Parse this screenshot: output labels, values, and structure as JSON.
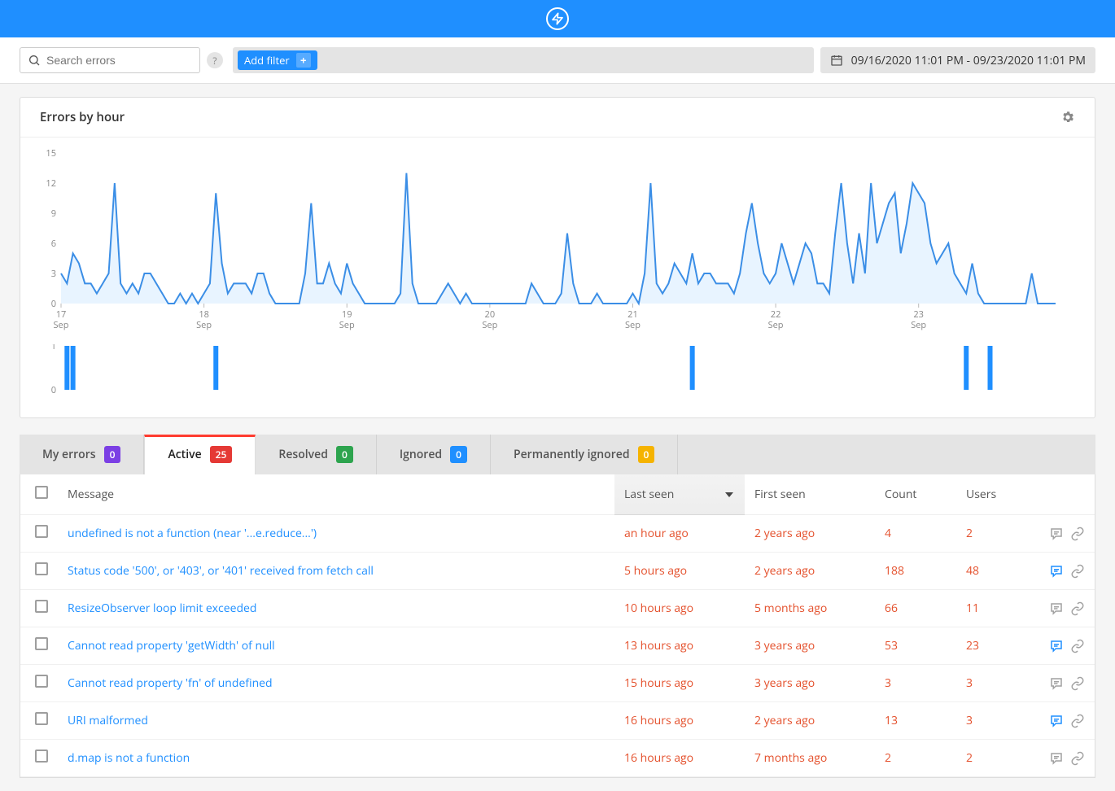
{
  "header": {
    "brand": "bolt"
  },
  "toolbar": {
    "search_placeholder": "Search errors",
    "help_label": "?",
    "add_filter_label": "Add filter",
    "date_range": "09/16/2020 11:01 PM - 09/23/2020 11:01 PM"
  },
  "chart": {
    "title": "Errors by hour",
    "y_ticks": [
      0,
      3,
      6,
      9,
      12,
      15
    ],
    "x_ticks": [
      {
        "day": "17",
        "month": "Sep"
      },
      {
        "day": "18",
        "month": "Sep"
      },
      {
        "day": "19",
        "month": "Sep"
      },
      {
        "day": "20",
        "month": "Sep"
      },
      {
        "day": "21",
        "month": "Sep"
      },
      {
        "day": "22",
        "month": "Sep"
      },
      {
        "day": "23",
        "month": "Sep"
      }
    ]
  },
  "mini_chart": {
    "y_ticks": [
      0,
      1
    ]
  },
  "tabs": [
    {
      "label": "My errors",
      "count": "0",
      "badge_class": "badge-purple"
    },
    {
      "label": "Active",
      "count": "25",
      "badge_class": "badge-red",
      "active": true
    },
    {
      "label": "Resolved",
      "count": "0",
      "badge_class": "badge-green"
    },
    {
      "label": "Ignored",
      "count": "0",
      "badge_class": "badge-blue"
    },
    {
      "label": "Permanently ignored",
      "count": "0",
      "badge_class": "badge-yellow"
    }
  ],
  "table": {
    "columns": {
      "message": "Message",
      "last_seen": "Last seen",
      "first_seen": "First seen",
      "count": "Count",
      "users": "Users"
    },
    "rows": [
      {
        "message": "undefined is not a function (near '...e.reduce...')",
        "last_seen": "an hour ago",
        "first_seen": "2 years ago",
        "count": "4",
        "users": "2",
        "has_comment": false
      },
      {
        "message": "Status code '500', or '403', or '401' received from fetch call",
        "last_seen": "5 hours ago",
        "first_seen": "2 years ago",
        "count": "188",
        "users": "48",
        "has_comment": true
      },
      {
        "message": "ResizeObserver loop limit exceeded",
        "last_seen": "10 hours ago",
        "first_seen": "5 months ago",
        "count": "66",
        "users": "11",
        "has_comment": false
      },
      {
        "message": "Cannot read property 'getWidth' of null",
        "last_seen": "13 hours ago",
        "first_seen": "3 years ago",
        "count": "53",
        "users": "23",
        "has_comment": true
      },
      {
        "message": "Cannot read property 'fn' of undefined",
        "last_seen": "15 hours ago",
        "first_seen": "3 years ago",
        "count": "3",
        "users": "3",
        "has_comment": false
      },
      {
        "message": "URI malformed",
        "last_seen": "16 hours ago",
        "first_seen": "2 years ago",
        "count": "13",
        "users": "3",
        "has_comment": true
      },
      {
        "message": "d.map is not a function",
        "last_seen": "16 hours ago",
        "first_seen": "7 months ago",
        "count": "2",
        "users": "2",
        "has_comment": false
      }
    ]
  },
  "chart_data": {
    "type": "line",
    "title": "Errors by hour",
    "xlabel": "",
    "ylabel": "",
    "ylim": [
      0,
      15
    ],
    "x_range": [
      "2020-09-17 00:00",
      "2020-09-23 23:00"
    ],
    "values": [
      3,
      2,
      5,
      4,
      2,
      2,
      1,
      2,
      3,
      12,
      2,
      1,
      2,
      1,
      3,
      3,
      2,
      1,
      0,
      0,
      1,
      0,
      1,
      0,
      1,
      2,
      11,
      4,
      1,
      2,
      2,
      2,
      1,
      3,
      3,
      1,
      0,
      0,
      0,
      0,
      0,
      3,
      10,
      2,
      2,
      4,
      2,
      1,
      4,
      2,
      1,
      0,
      0,
      0,
      0,
      0,
      0,
      1,
      13,
      2,
      0,
      0,
      0,
      0,
      1,
      2,
      1,
      0,
      1,
      0,
      0,
      0,
      0,
      0,
      0,
      0,
      0,
      0,
      0,
      2,
      1,
      0,
      0,
      0,
      1,
      7,
      2,
      0,
      0,
      0,
      1,
      0,
      0,
      0,
      0,
      0,
      1,
      0,
      3,
      12,
      2,
      1,
      2,
      4,
      3,
      2,
      5,
      2,
      3,
      3,
      2,
      2,
      2,
      1,
      3,
      7,
      10,
      6,
      3,
      2,
      3,
      6,
      4,
      2,
      4,
      6,
      5,
      2,
      2,
      1,
      7,
      12,
      6,
      2,
      7,
      3,
      12,
      6,
      8,
      10,
      11,
      5,
      8,
      12,
      11,
      10,
      6,
      4,
      5,
      6,
      3,
      2,
      1,
      4,
      1,
      0,
      0,
      0,
      0,
      0,
      0,
      0,
      0,
      3,
      0,
      0,
      0,
      0
    ],
    "mini_series": {
      "type": "bar",
      "ylim": [
        0,
        1
      ],
      "bars": [
        {
          "index": 1,
          "value": 1
        },
        {
          "index": 2,
          "value": 1
        },
        {
          "index": 26,
          "value": 1
        },
        {
          "index": 106,
          "value": 1
        },
        {
          "index": 152,
          "value": 1
        },
        {
          "index": 156,
          "value": 1
        }
      ],
      "total_slots": 168
    }
  }
}
